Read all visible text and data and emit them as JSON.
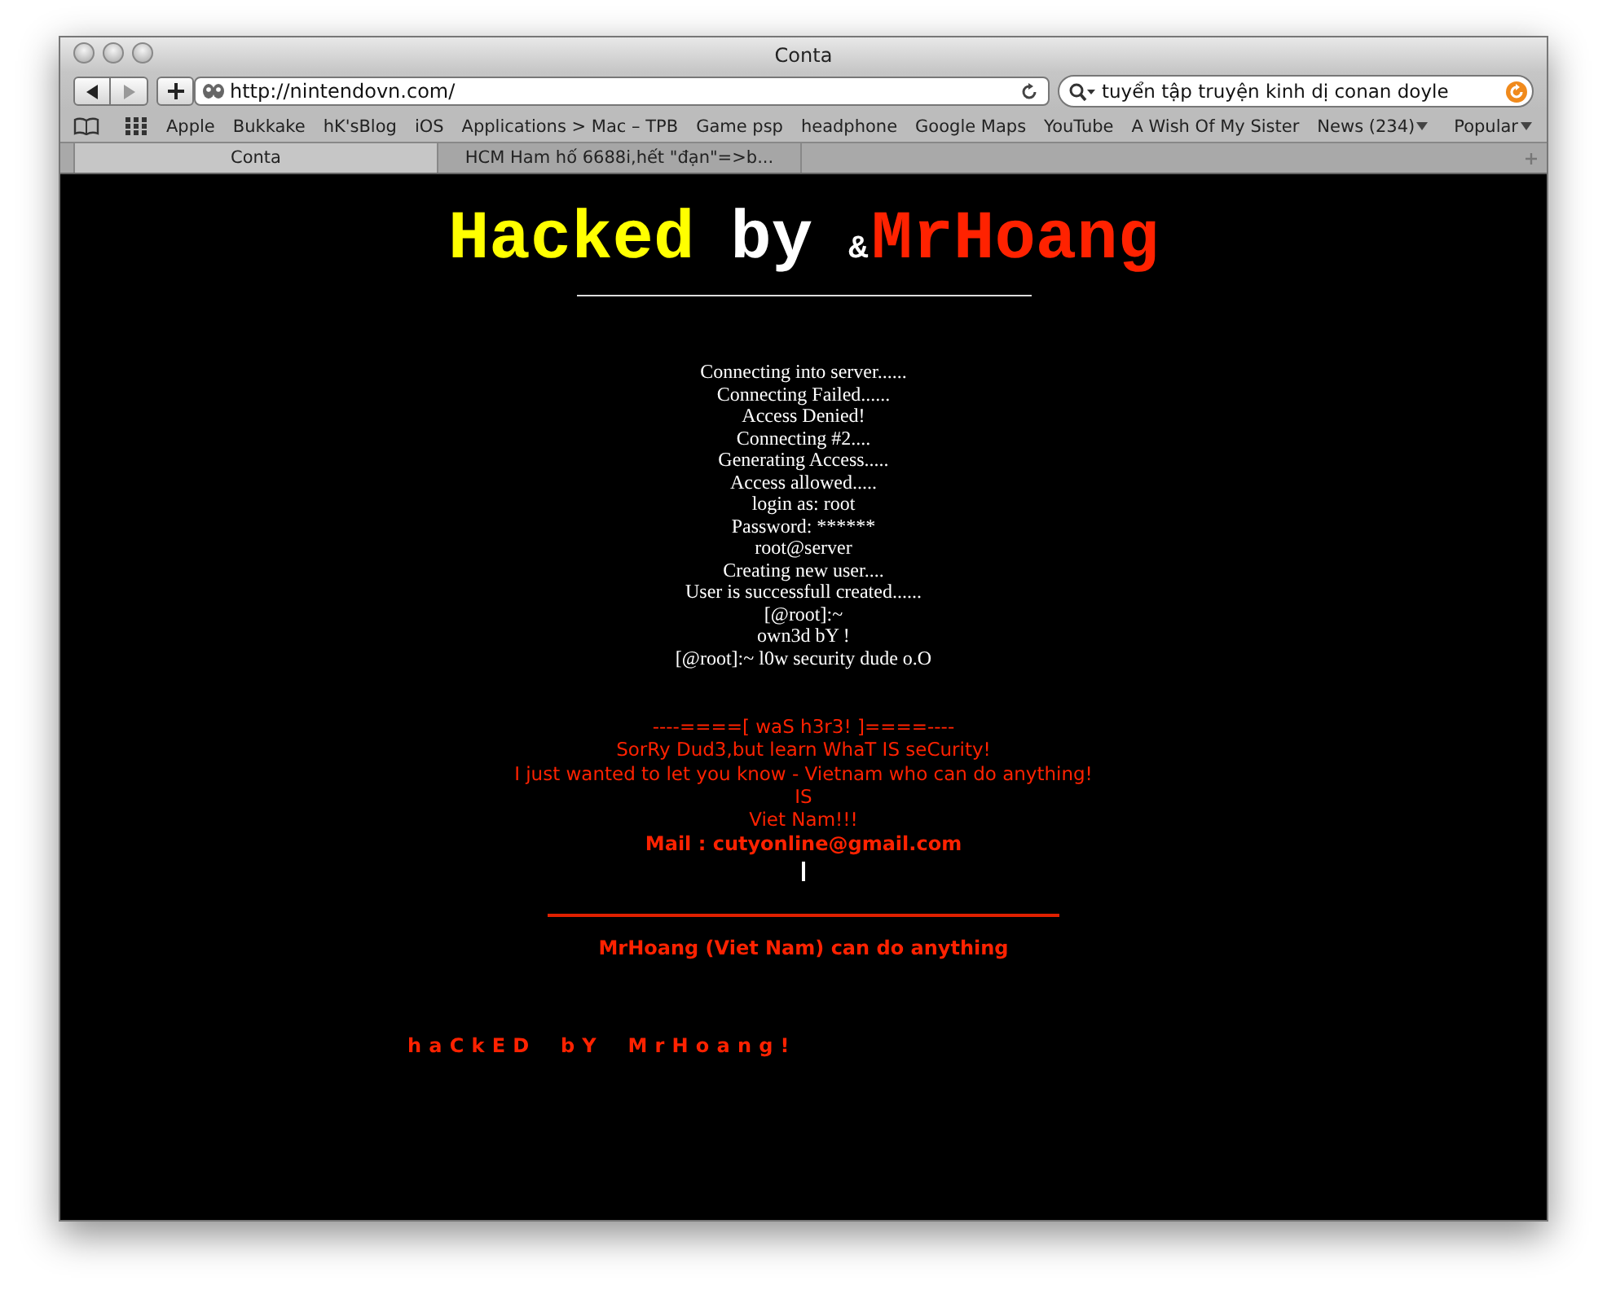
{
  "window": {
    "title": "Conta"
  },
  "toolbar": {
    "url": "http://nintendovn.com/",
    "search": "tuyển tập truyện kinh dị conan doyle"
  },
  "bookmarks": [
    {
      "label": "Apple",
      "dropdown": false
    },
    {
      "label": "Bukkake",
      "dropdown": false
    },
    {
      "label": "hK'sBlog",
      "dropdown": false
    },
    {
      "label": "iOS",
      "dropdown": false
    },
    {
      "label": "Applications > Mac – TPB",
      "dropdown": false
    },
    {
      "label": "Game psp",
      "dropdown": false
    },
    {
      "label": "headphone",
      "dropdown": false
    },
    {
      "label": "Google Maps",
      "dropdown": false
    },
    {
      "label": "YouTube",
      "dropdown": false
    },
    {
      "label": "A Wish Of My Sister",
      "dropdown": false
    },
    {
      "label": "News (234)",
      "dropdown": true
    },
    {
      "label": "Popular",
      "dropdown": true
    }
  ],
  "tabs": [
    {
      "label": "Conta",
      "selected": true
    },
    {
      "label": "HCM Ham hố 6688i,hết \"đạn\"=>b...",
      "selected": false
    }
  ],
  "page": {
    "headline": [
      {
        "text": "Hacked",
        "kind": "big",
        "color": "#ffff00"
      },
      {
        "text": "by",
        "kind": "big",
        "color": "#ffffff"
      },
      {
        "text": "&",
        "kind": "small",
        "color": "#ffffff"
      },
      {
        "text": "MrHoang",
        "kind": "big",
        "color": "#ff2200"
      }
    ],
    "log_lines": [
      "Connecting into server......",
      "Connecting Failed......",
      "Access Denied!",
      "Connecting #2....",
      "Generating Access.....",
      "Access allowed.....",
      "login as: root",
      "Password: ******",
      "root@server",
      "Creating new user....",
      "User is successfull created......",
      "[@root]:~",
      "own3d bY !",
      "[@root]:~ l0w security dude o.O"
    ],
    "message_lines": [
      {
        "text": "----====[ waS h3r3! ]====----",
        "kind": "normal"
      },
      {
        "text": "SorRy Dud3,but learn WhaT IS seCurity!",
        "kind": "normal"
      },
      {
        "text": "I just wanted to let you know - Vietnam who can do anything!",
        "kind": "normal"
      },
      {
        "text": "IS",
        "kind": "normal"
      },
      {
        "text": "Viet Nam!!!",
        "kind": "normal"
      },
      {
        "text": "Mail : cutyonline@gmail.com",
        "kind": "bold"
      }
    ],
    "tagline": "MrHoang (Viet Nam) can do anything",
    "signature": "haCkED bY MrHoang!"
  }
}
